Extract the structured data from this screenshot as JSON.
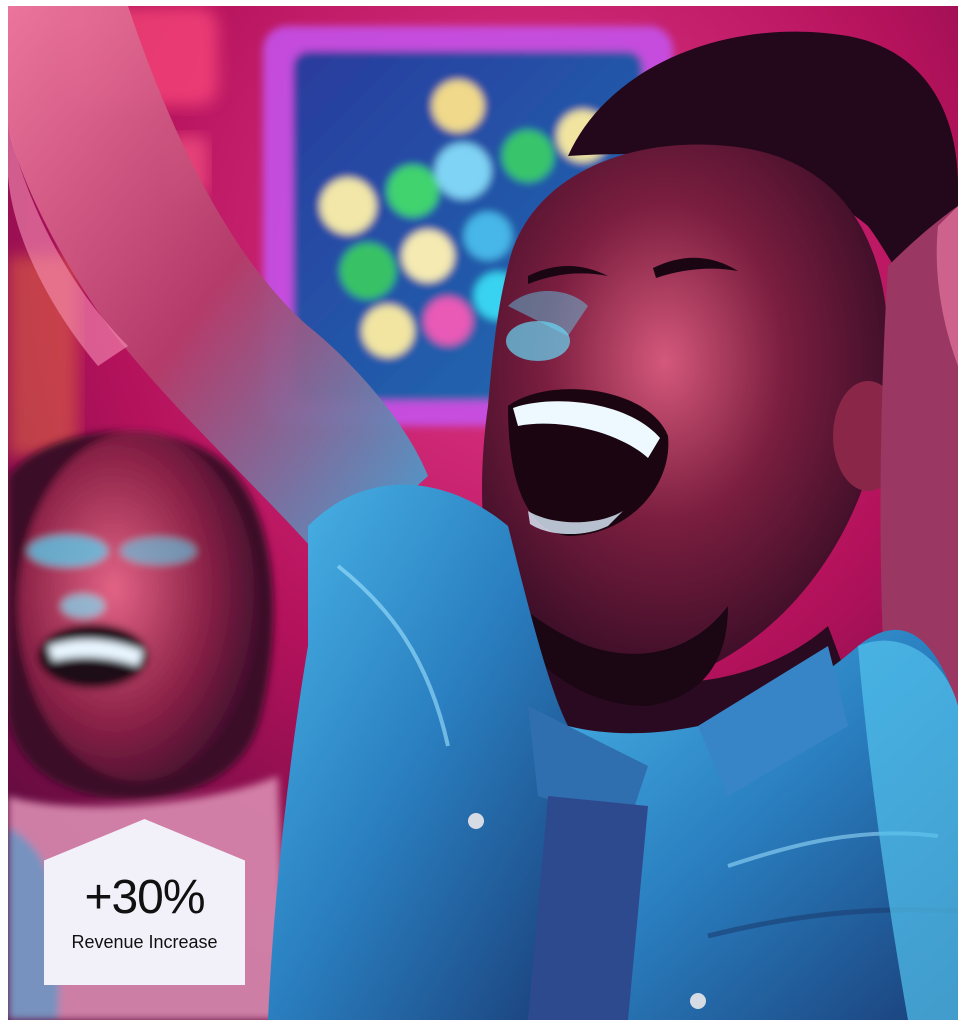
{
  "stat": {
    "value": "+30%",
    "label": "Revenue Increase"
  },
  "colors": {
    "badge_bg": "#f2f1fa",
    "text": "#111111",
    "neon_pink": "#e0146e",
    "neon_cyan": "#25c8f0"
  },
  "image": {
    "icon": "celebrating-people-photo"
  }
}
